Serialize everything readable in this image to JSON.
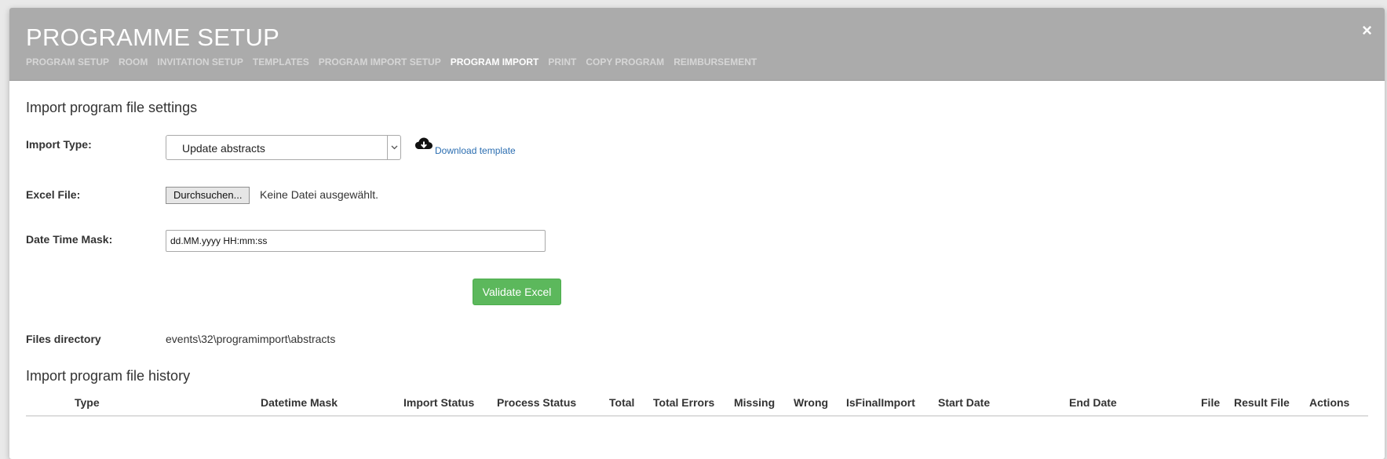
{
  "header": {
    "title": "PROGRAMME SETUP",
    "close_label": "×",
    "tabs": [
      {
        "label": "PROGRAM SETUP",
        "active": false
      },
      {
        "label": "ROOM",
        "active": false
      },
      {
        "label": "INVITATION SETUP",
        "active": false
      },
      {
        "label": "TEMPLATES",
        "active": false
      },
      {
        "label": "PROGRAM IMPORT SETUP",
        "active": false
      },
      {
        "label": "PROGRAM IMPORT",
        "active": true
      },
      {
        "label": "PRINT",
        "active": false
      },
      {
        "label": "COPY PROGRAM",
        "active": false
      },
      {
        "label": "REIMBURSEMENT",
        "active": false
      }
    ]
  },
  "settings": {
    "section_title": "Import program file settings",
    "import_type_label": "Import Type:",
    "import_type_value": "Update abstracts",
    "download_label": "Download template",
    "download_icon": "cloud-download-icon",
    "excel_file_label": "Excel File:",
    "browse_label": "Durchsuchen...",
    "file_status": "Keine Datei ausgewählt.",
    "date_mask_label": "Date Time Mask:",
    "date_mask_value": "dd.MM.yyyy HH:mm:ss",
    "validate_label": "Validate Excel",
    "files_dir_label": "Files directory",
    "files_dir_value": "events\\32\\programimport\\abstracts"
  },
  "history": {
    "section_title": "Import program file history",
    "columns": [
      "Type",
      "Datetime Mask",
      "Import Status",
      "Process Status",
      "Total",
      "Total Errors",
      "Missing",
      "Wrong",
      "IsFinalImport",
      "Start Date",
      "End Date",
      "File",
      "Result File",
      "Actions"
    ]
  },
  "colors": {
    "header_bg": "#ababab",
    "accent_green": "#5cb85c",
    "link_blue": "#2a6db0"
  }
}
